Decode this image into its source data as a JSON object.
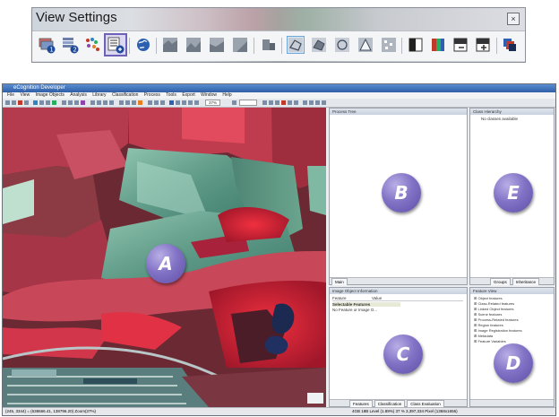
{
  "view_settings": {
    "title": "View Settings",
    "close_glyph": "×",
    "tools": [
      {
        "name": "layer-1-icon"
      },
      {
        "name": "layer-2-icon"
      },
      {
        "name": "classify-dots-icon"
      },
      {
        "name": "four-pane-layout-icon",
        "selected": true
      },
      {
        "name": "globe-icon"
      },
      {
        "name": "map-view-1-icon"
      },
      {
        "name": "map-view-2-icon"
      },
      {
        "name": "map-view-3-icon"
      },
      {
        "name": "map-view-4-icon"
      },
      {
        "name": "split-view-icon"
      },
      {
        "name": "polygon-outline-icon",
        "highlighted": true
      },
      {
        "name": "polygon-fill-icon"
      },
      {
        "name": "polygon-view-3-icon"
      },
      {
        "name": "polygon-view-4-icon"
      },
      {
        "name": "polygon-view-5-icon"
      },
      {
        "name": "single-band-icon"
      },
      {
        "name": "rgb-band-icon"
      },
      {
        "name": "band-minus-icon"
      },
      {
        "name": "band-plus-icon"
      },
      {
        "name": "layer-stack-icon"
      }
    ]
  },
  "app": {
    "title": "eCognition Developer",
    "menu": [
      "File",
      "View",
      "Image Objects",
      "Analysis",
      "Library",
      "Classification",
      "Process",
      "Tools",
      "Export",
      "Window",
      "Help"
    ],
    "zoom": "37%",
    "status_left": "(245, 3344) = (638666.41, 138796.20)  Zoom(37%)",
    "status_right": "4GB  18B  Level (1.89%)  37 %  3,397,334 Pixel  (1368x1656)"
  },
  "panes": {
    "B": {
      "header": "Process Tree",
      "tabs": [
        "Main"
      ]
    },
    "E": {
      "header": "Class Hierarchy",
      "empty_text": "No classes available",
      "tabs": [
        "Groups",
        "Inheritance"
      ]
    },
    "C": {
      "header": "Image Object Information",
      "columns": [
        "Feature",
        "Value"
      ],
      "rows": [
        "Selectable Features",
        "No Feature or Image O..."
      ],
      "tabs": [
        "Features",
        "Classification",
        "Class Evaluation"
      ]
    },
    "D": {
      "header": "Feature View",
      "tree": [
        "Object features",
        "Class-Related features",
        "Linked Object features",
        "Scene features",
        "Process-Related features",
        "Region features",
        "Image Registration features",
        "Metadata",
        "Feature Variables"
      ]
    }
  },
  "labels": {
    "A": "A",
    "B": "B",
    "C": "C",
    "D": "D",
    "E": "E"
  },
  "colors": {
    "selected_outline": "#6d62b8",
    "label_circle": "#7a6bc2",
    "vegetation_red": "#d9263a",
    "field_green": "#6fa792"
  }
}
